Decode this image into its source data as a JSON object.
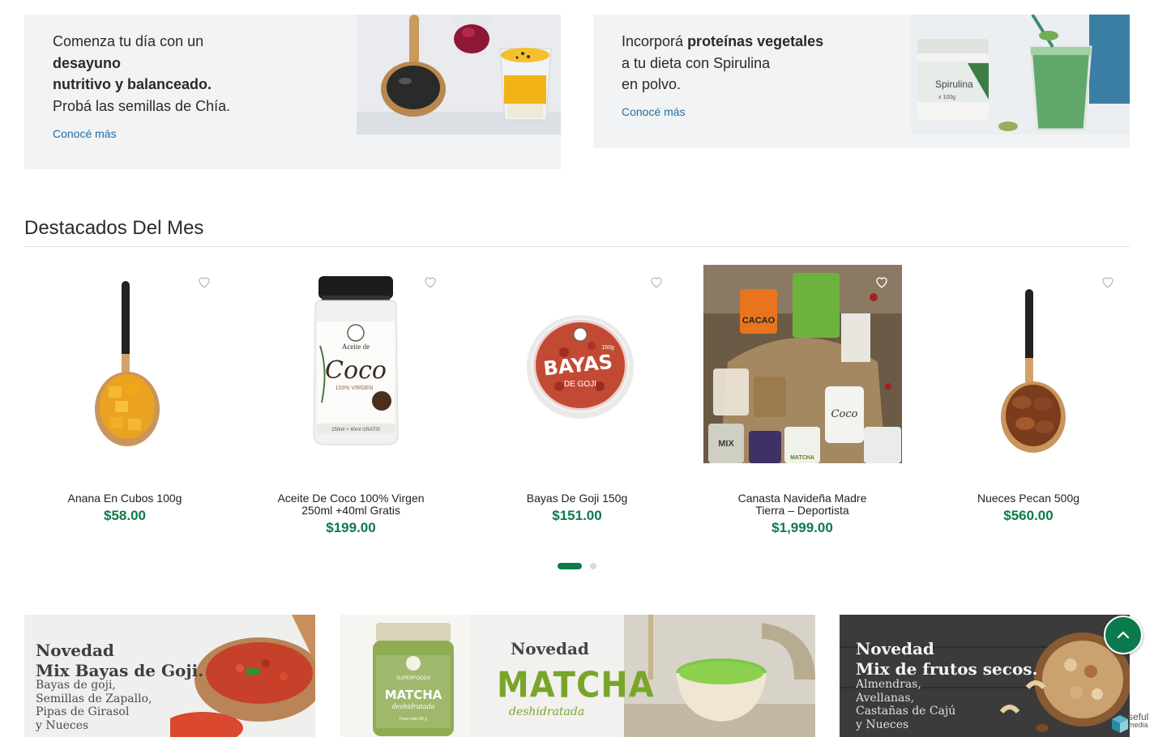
{
  "promos": {
    "left": {
      "line1": "Comenza tu día con un",
      "line2_bold": "desayuno",
      "line3_bold": "nutritivo y balanceado.",
      "line4": "Probá las semillas de Chía.",
      "link": "Conocé más"
    },
    "right": {
      "line1_pre": "Incorporá",
      "line1_bold": "proteínas vegetales",
      "line2": "a tu dieta con Spirulina",
      "line3": "en polvo.",
      "link": "Conocé más",
      "jar_label": "Spirulina",
      "jar_weight": "x 100g"
    }
  },
  "section": {
    "title": "Destacados Del Mes"
  },
  "products": [
    {
      "name": "Anana En Cubos 100g",
      "price": "$58.00",
      "image": "spoon-pineapple-cubes"
    },
    {
      "name": "Aceite De Coco 100% Virgen 250ml +40ml Gratis",
      "price": "$199.00",
      "image": "coconut-oil-jar",
      "jar_title": "Aceite de",
      "jar_brand": "Coco",
      "jar_sub": "100% VIRGEN",
      "jar_foot": "250ml + 40ml GRATIS"
    },
    {
      "name": "Bayas De Goji 150g",
      "price": "$151.00",
      "image": "goji-berries-tub",
      "tub_title": "BAYAS",
      "tub_sub": "DE GOJI",
      "tub_weight": "150g"
    },
    {
      "name": "Canasta Navideña Madre Tierra – Deportista",
      "price": "$1,999.00",
      "image": "christmas-basket",
      "label_cacao": "CACAO",
      "label_coco": "Coco",
      "label_mix": "MIX",
      "label_matcha": "MATCHA"
    },
    {
      "name": "Nueces Pecan 500g",
      "price": "$560.00",
      "image": "spoon-pecans"
    }
  ],
  "pagination": {
    "pages": 2,
    "current": 1
  },
  "banners": {
    "goji": {
      "title1": "Novedad",
      "title2": "Mix Bayas de Goji.",
      "lines": [
        "Bayas de goji,",
        "Semillas de Zapallo,",
        "Pipas de Girasol",
        "y Nueces"
      ]
    },
    "matcha": {
      "head": "Novedad",
      "big": "MATCHA",
      "small": "deshidratada",
      "jar_top": "SUPERFOODS",
      "jar_label": "MATCHA",
      "jar_sub": "deshidratada",
      "jar_weight": "Peso neto 80 g"
    },
    "nuts": {
      "title1": "Novedad",
      "title2": "Mix de frutos secos.",
      "lines": [
        "Almendras,",
        "Avellanas,",
        "Castañas de Cajú",
        "y Nueces"
      ]
    }
  },
  "brand": {
    "line1": "seful",
    "line2": "media"
  },
  "colors": {
    "accent": "#0b7a4c",
    "price": "#0e7a4a",
    "link": "#1f6fa5",
    "promo_bg": "#f2f3f5"
  }
}
